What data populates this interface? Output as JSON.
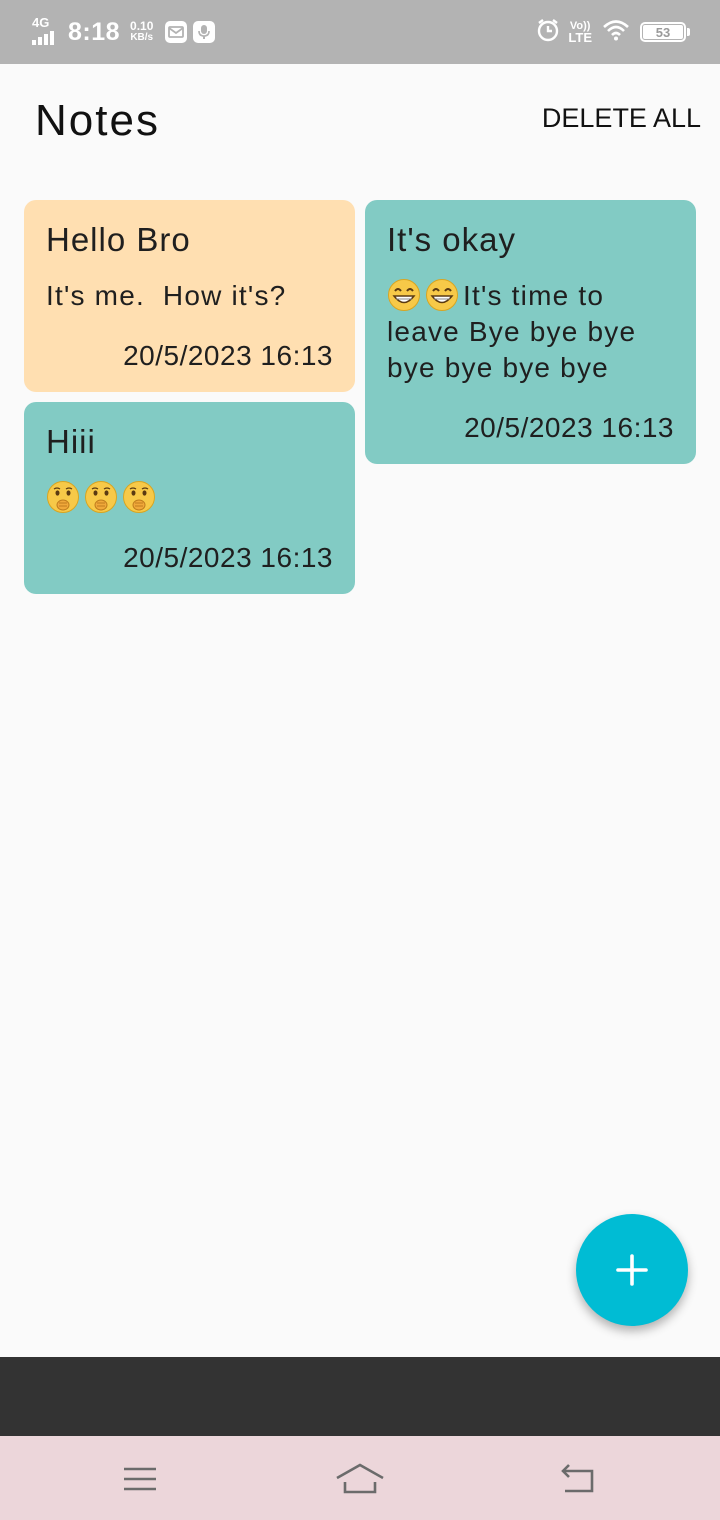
{
  "status_bar": {
    "network": "4G",
    "time": "8:18",
    "speed_value": "0.10",
    "speed_unit": "KB/s",
    "notification_icons": [
      "mail-icon",
      "microphone-icon"
    ],
    "volte_top": "Vo))",
    "volte_bottom": "LTE",
    "battery_level": "53",
    "right_icons": [
      "alarm-icon",
      "wifi-icon",
      "battery-icon"
    ]
  },
  "header": {
    "title": "Notes",
    "delete_all_label": "DELETE ALL"
  },
  "notes": [
    {
      "title": "Hello Bro",
      "body": "It's me.  How it's?",
      "date": "20/5/2023 16:13",
      "color": "#ffdfb1"
    },
    {
      "title": "Hiii",
      "emojis": [
        "shushing-face",
        "shushing-face",
        "shushing-face"
      ],
      "date": "20/5/2023 16:13",
      "color": "#82cbc4"
    },
    {
      "title": "It's okay",
      "emojis": [
        "grinning-face",
        "grinning-face"
      ],
      "body": "It's time to leave Bye bye bye bye bye bye bye",
      "date": "20/5/2023 16:13",
      "color": "#82cbc4"
    }
  ],
  "fab": {
    "icon": "plus-icon",
    "color": "#00bcd4"
  },
  "nav_bar": {
    "buttons": [
      "menu-icon",
      "home-icon",
      "back-icon"
    ]
  },
  "colors": {
    "background": "#fafafa",
    "status_bar": "#b3b3b3",
    "bottom_strip": "#333333",
    "nav_bar": "#ecd6da"
  }
}
